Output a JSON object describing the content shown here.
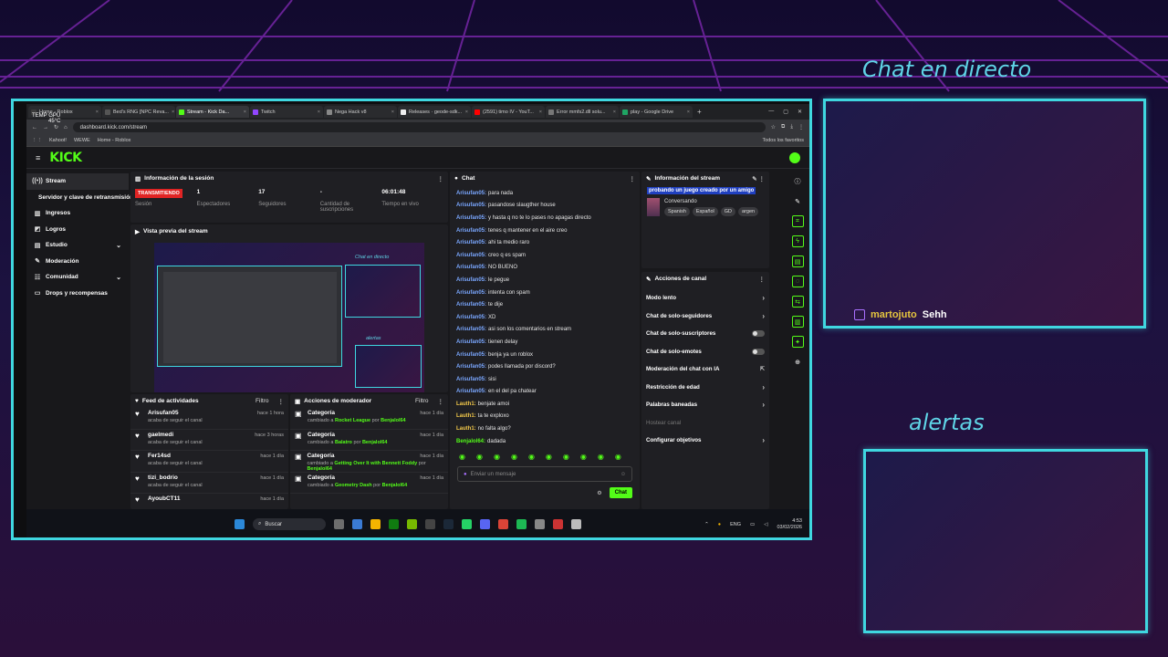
{
  "overlay": {
    "chat_title": "Chat en directo",
    "alerts_title": "alertas",
    "chat_user": "martojuto",
    "chat_message": "Sehh"
  },
  "browser": {
    "tabs": [
      {
        "label": "Home - Roblox",
        "color": "#3c3c3c"
      },
      {
        "label": "Bed's RNG [NPC Reva...",
        "color": "#555555"
      },
      {
        "label": "Stream - Kick Da...",
        "color": "#53fc18",
        "active": true
      },
      {
        "label": "Twitch",
        "color": "#9146ff"
      },
      {
        "label": "Nega Hack v8",
        "color": "#888888"
      },
      {
        "label": "Releases · geode-sdk...",
        "color": "#eeeeee"
      },
      {
        "label": "(2591) timo IV - YouT...",
        "color": "#ff0000"
      },
      {
        "label": "Error mmfs2.dll solu...",
        "color": "#777777"
      },
      {
        "label": "play - Google Drive",
        "color": "#1fa463"
      }
    ],
    "temp_label": "TEMP GPU",
    "temp_value": "45°C",
    "url": "dashboard.kick.com/stream",
    "bookmarks": [
      "Kahoot!",
      "WEWE",
      "Home - Roblox"
    ],
    "bookmarks_right": "Todos los favoritos"
  },
  "kick": {
    "logo": "KICK",
    "sidebar": [
      {
        "icon": "((•))",
        "label": "Stream",
        "active": true
      },
      {
        "icon": "",
        "label": "Servidor y clave de retransmisión"
      },
      {
        "icon": "▥",
        "label": "Ingresos"
      },
      {
        "icon": "◩",
        "label": "Logros"
      },
      {
        "icon": "▤",
        "label": "Estudio",
        "chev": "⌄"
      },
      {
        "icon": "✎",
        "label": "Moderación"
      },
      {
        "icon": "☷",
        "label": "Comunidad",
        "chev": "⌄"
      },
      {
        "icon": "▭",
        "label": "Drops y recompensas"
      }
    ],
    "session": {
      "title": "Información de la sesión",
      "live_badge": "TRANSMITIENDO",
      "stats": [
        {
          "value": "",
          "label": "Sesión"
        },
        {
          "value": "1",
          "label": "Espectadores"
        },
        {
          "value": "17",
          "label": "Seguidores"
        },
        {
          "value": "-",
          "label": "Cantidad de suscripciones"
        },
        {
          "value": "06:01:48",
          "label": "Tiempo en vivo"
        }
      ]
    },
    "preview": {
      "title": "Vista previa del stream",
      "chat_title": "Chat en directo",
      "alerts_title": "alertas"
    },
    "feed": {
      "title": "Feed de actividades",
      "filter": "Filtro",
      "items": [
        {
          "name": "Arisufan05",
          "sub": "acaba de seguir el canal",
          "time": "hace 1 hora"
        },
        {
          "name": "gaelmedi",
          "sub": "acaba de seguir el canal",
          "time": "hace 3 horas"
        },
        {
          "name": "Fer14sd",
          "sub": "acaba de seguir el canal",
          "time": "hace 1 día"
        },
        {
          "name": "tizi_bodrio",
          "sub": "acaba de seguir el canal",
          "time": "hace 1 día"
        },
        {
          "name": "AyoubCT11",
          "sub": "",
          "time": "hace 1 día"
        }
      ]
    },
    "modactions": {
      "title": "Acciones de moderador",
      "filter": "Filtro",
      "items": [
        {
          "name": "Categoría",
          "pre": "cambiado a ",
          "game": "Rocket League",
          "by": " por ",
          "user": "Benjalol64",
          "time": "hace 1 día"
        },
        {
          "name": "Categoría",
          "pre": "cambiado a ",
          "game": "Balatro",
          "by": " por ",
          "user": "Benjalol64",
          "time": "hace 1 día"
        },
        {
          "name": "Categoría",
          "pre": "cambiado a ",
          "game": "Getting Over It with Bennett Foddy",
          "by": " por ",
          "user": "Benjalol64",
          "time": "hace 1 día"
        },
        {
          "name": "Categoría",
          "pre": "cambiado a ",
          "game": "Geometry Dash",
          "by": " por ",
          "user": "Benjalol64",
          "time": "hace 1 día"
        }
      ]
    },
    "chat": {
      "title": "Chat",
      "messages": [
        {
          "user": "Arisufan05:",
          "text": "para nada",
          "color": "b"
        },
        {
          "user": "Arisufan05:",
          "text": "pasandose slaugther house",
          "color": "b"
        },
        {
          "user": "Arisufan05:",
          "text": "y hasta q no te lo pases no apagas directo",
          "color": "b"
        },
        {
          "user": "Arisufan05:",
          "text": "tenes q mantener en el aire creo",
          "color": "b"
        },
        {
          "user": "Arisufan05:",
          "text": "ahi ta medio raro",
          "color": "b"
        },
        {
          "user": "Arisufan05:",
          "text": "creo q es spam",
          "color": "b"
        },
        {
          "user": "Arisufan05:",
          "text": "NO BUENO",
          "color": "b"
        },
        {
          "user": "Arisufan05:",
          "text": "le pegue",
          "color": "b"
        },
        {
          "user": "Arisufan05:",
          "text": "intenta con spam",
          "color": "b"
        },
        {
          "user": "Arisufan05:",
          "text": "te dije",
          "color": "b"
        },
        {
          "user": "Arisufan05:",
          "text": "XD",
          "color": "b"
        },
        {
          "user": "Arisufan05:",
          "text": "asi son los comentarios en stream",
          "color": "b"
        },
        {
          "user": "Arisufan05:",
          "text": "tienen delay",
          "color": "b"
        },
        {
          "user": "Arisufan05:",
          "text": "benja ya un roblox",
          "color": "b"
        },
        {
          "user": "Arisufan05:",
          "text": "podes llamada por discord?",
          "color": "b"
        },
        {
          "user": "Arisufan05:",
          "text": "sisi",
          "color": "b"
        },
        {
          "user": "Arisufan05:",
          "text": "en el del pa chatear",
          "color": "b"
        },
        {
          "user": "Lauth1:",
          "text": "benjate amoi",
          "color": "y"
        },
        {
          "user": "Lauth1:",
          "text": "ta te exploxo",
          "color": "y"
        },
        {
          "user": "Lauth1:",
          "text": "no falta algo?",
          "color": "y"
        },
        {
          "user": "Benjalol64:",
          "text": "dadada",
          "color": "g"
        }
      ],
      "input_placeholder": "Enviar un mensaje",
      "send": "Chat"
    },
    "streaminfo": {
      "title": "Información del stream",
      "stream_title": "probando un juego creado por un amigo",
      "category": "Conversando",
      "tags": [
        "Spanish",
        "Español",
        "GD",
        "argen"
      ]
    },
    "channel_actions": {
      "title": "Acciones de canal",
      "items": [
        {
          "label": "Modo lento",
          "kind": "arrow"
        },
        {
          "label": "Chat de solo-seguidores",
          "kind": "arrow"
        },
        {
          "label": "Chat de solo-suscriptores",
          "kind": "toggle"
        },
        {
          "label": "Chat de solo-emotes",
          "kind": "toggle"
        },
        {
          "label": "Moderación del chat con IA",
          "kind": "ext"
        },
        {
          "label": "Restricción de edad",
          "kind": "arrow"
        },
        {
          "label": "Palabras baneadas",
          "kind": "arrow"
        },
        {
          "label": "Hostear canal",
          "kind": "dim"
        },
        {
          "label": "Configurar objetivos",
          "kind": "arrow"
        }
      ]
    }
  },
  "taskbar": {
    "search": "Buscar",
    "lang": "ENG",
    "time": "4:53",
    "date": "03/02/2026"
  }
}
